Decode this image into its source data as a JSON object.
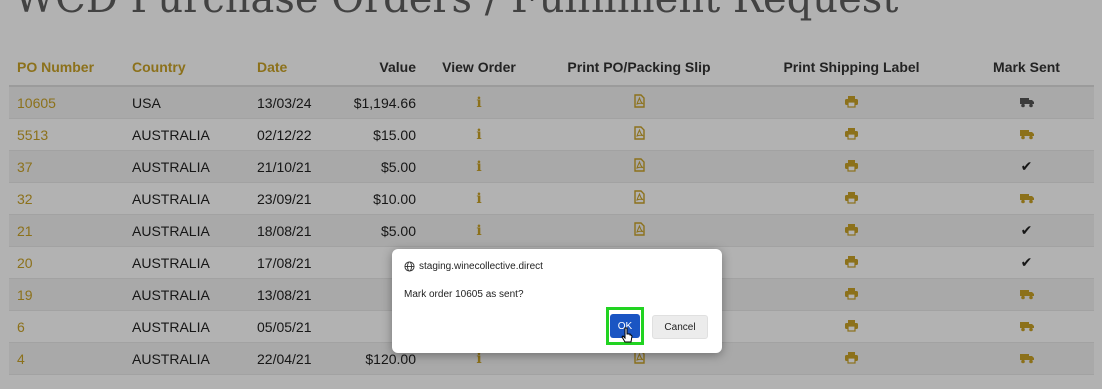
{
  "page": {
    "title": "WCD Purchase Orders / Fulfilment Request"
  },
  "table": {
    "headers": {
      "po_number": "PO Number",
      "country": "Country",
      "date": "Date",
      "value": "Value",
      "view_order": "View Order",
      "print_po": "Print PO/Packing Slip",
      "print_label": "Print Shipping Label",
      "mark_sent": "Mark Sent"
    },
    "rows": [
      {
        "po": "10605",
        "country": "USA",
        "date": "13/03/24",
        "value": "$1,194.66",
        "sent": false
      },
      {
        "po": "5513",
        "country": "AUSTRALIA",
        "date": "02/12/22",
        "value": "$15.00",
        "sent": false
      },
      {
        "po": "37",
        "country": "AUSTRALIA",
        "date": "21/10/21",
        "value": "$5.00",
        "sent": true
      },
      {
        "po": "32",
        "country": "AUSTRALIA",
        "date": "23/09/21",
        "value": "$10.00",
        "sent": false
      },
      {
        "po": "21",
        "country": "AUSTRALIA",
        "date": "18/08/21",
        "value": "$5.00",
        "sent": true
      },
      {
        "po": "20",
        "country": "AUSTRALIA",
        "date": "17/08/21",
        "value": "",
        "sent": true
      },
      {
        "po": "19",
        "country": "AUSTRALIA",
        "date": "13/08/21",
        "value": "",
        "sent": false
      },
      {
        "po": "6",
        "country": "AUSTRALIA",
        "date": "05/05/21",
        "value": "",
        "sent": false
      },
      {
        "po": "4",
        "country": "AUSTRALIA",
        "date": "22/04/21",
        "value": "$120.00",
        "sent": false
      }
    ]
  },
  "icons": {
    "view_order": "info-icon",
    "print_po": "pdf-file-icon",
    "print_label": "printer-icon",
    "mark_sent_pending": "truck-icon",
    "mark_sent_done": "checkmark-icon"
  },
  "dialog": {
    "origin": "staging.winecollective.direct",
    "message": "Mark order 10605 as sent?",
    "ok_label": "OK",
    "cancel_label": "Cancel"
  },
  "colors": {
    "gold": "#c9a227",
    "ok_button": "#1a55c3",
    "highlight": "#21d321"
  }
}
